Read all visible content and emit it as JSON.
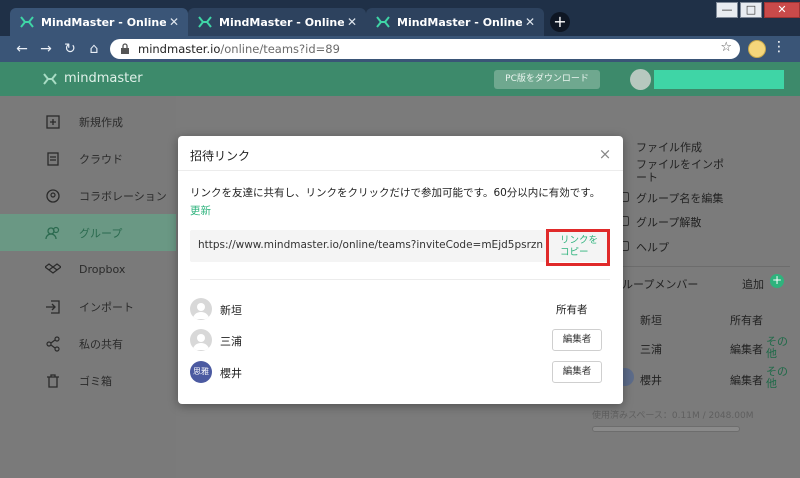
{
  "browser": {
    "tabs": [
      {
        "title": "MindMaster - Online Mind Ma"
      },
      {
        "title": "MindMaster - Online Mind Ma"
      },
      {
        "title": "MindMaster - Online Mind Ma"
      }
    ],
    "new_tab_label": "+",
    "window_controls": {
      "minimize": "—",
      "maximize": "□",
      "close": "✕"
    },
    "url_host": "mindmaster.io",
    "url_path": "/online/teams?id=89"
  },
  "header": {
    "brand": "mindmaster",
    "download_label": "PC版をダウンロード"
  },
  "sidebar": {
    "items": [
      {
        "label": "新規作成",
        "icon": "new-file-icon"
      },
      {
        "label": "クラウド",
        "icon": "cloud-icon"
      },
      {
        "label": "コラボレーション",
        "icon": "collaboration-icon"
      },
      {
        "label": "グループ",
        "icon": "group-icon",
        "active": true
      },
      {
        "label": "Dropbox",
        "icon": "dropbox-icon"
      },
      {
        "label": "インポート",
        "icon": "import-icon"
      },
      {
        "label": "私の共有",
        "icon": "share-icon"
      },
      {
        "label": "ゴミ箱",
        "icon": "trash-icon"
      }
    ]
  },
  "right_panel": {
    "menu": [
      "ファイル作成",
      "ファイルをインポート",
      "グループ名を編集",
      "グループ解散",
      "ヘルプ"
    ],
    "members_title": "ループメンバー",
    "add_label": "追加",
    "members": [
      {
        "name": "新垣",
        "role": "所有者"
      },
      {
        "name": "三浦",
        "role": "編集者",
        "other": "その他"
      },
      {
        "name": "櫻井",
        "role": "編集者",
        "other": "その他"
      }
    ],
    "storage_text": "使用済みスペース：0.11M / 2048.00M"
  },
  "modal": {
    "title": "招待リンク",
    "close": "×",
    "description": "リンクを友達に共有し、リンクをクリックだけで参加可能です。60分以内に有効です。",
    "refresh_label": "更新",
    "invite_link": "https://www.mindmaster.io/online/teams?inviteCode=mEjd5psrzn",
    "copy_label": "リンクをコピー",
    "members": [
      {
        "name": "新垣",
        "role": "所有者"
      },
      {
        "name": "三浦",
        "role": "編集者"
      },
      {
        "name": "櫻井",
        "role": "編集者",
        "avatar_text": "思雅"
      }
    ]
  },
  "colors": {
    "accent_green": "#2fb37d",
    "header_green": "#3d8a6b",
    "chrome_dark": "#1f3047",
    "highlight_red": "#e02a2a"
  }
}
